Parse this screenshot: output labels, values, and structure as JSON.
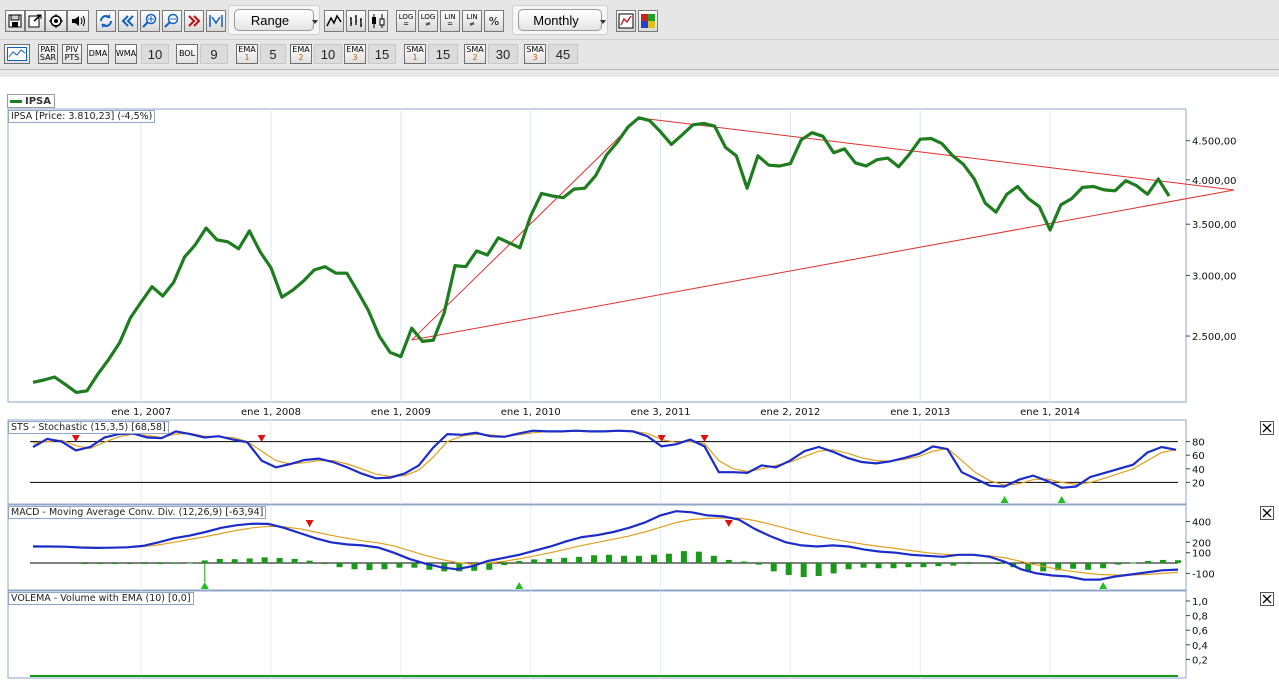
{
  "toolbar": {
    "range_label": "Range",
    "period_label": "Monthly",
    "icons": [
      "save-icon",
      "export-icon",
      "settings-icon",
      "sound-icon",
      "refresh-icon",
      "scroll-back-icon",
      "zoom-in-icon",
      "zoom-out-icon",
      "fast-forward-icon",
      "fit-icon",
      "line-chart-icon",
      "bar-chart-icon",
      "candlestick-icon",
      "log-equal-icon",
      "log-notequal-icon",
      "lin-equal-icon",
      "lin-notequal-icon",
      "percent-icon",
      "chart-settings-icon",
      "color-palette-icon"
    ],
    "scale_buttons": [
      {
        "top": "LOG",
        "bottom": "="
      },
      {
        "top": "LOG",
        "bottom": "≠"
      },
      {
        "top": "LIN",
        "bottom": "="
      },
      {
        "top": "LIN",
        "bottom": "≠"
      },
      {
        "top": "%",
        "bottom": ""
      }
    ]
  },
  "indicators_bar": {
    "buttons": [
      {
        "top": "PAR",
        "bottom": "SAR"
      },
      {
        "top": "PIV",
        "bottom": "PTS"
      },
      {
        "top": "DMA",
        "bottom": ""
      },
      {
        "top": "WMA",
        "bottom": ""
      },
      {
        "top": "BOL",
        "bottom": ""
      },
      {
        "top": "EMA",
        "bottom": "1"
      },
      {
        "top": "EMA",
        "bottom": "2"
      },
      {
        "top": "EMA",
        "bottom": "3"
      },
      {
        "top": "SMA",
        "bottom": "1"
      },
      {
        "top": "SMA",
        "bottom": "2"
      },
      {
        "top": "SMA",
        "bottom": "3"
      }
    ],
    "values": [
      "10",
      "9",
      "5",
      "10",
      "15",
      "15",
      "30",
      "45"
    ]
  },
  "legend": {
    "symbol": "IPSA"
  },
  "price_panel": {
    "label": "IPSA [Price: 3.810,23] (-4,5%)",
    "y_ticks": [
      "4.500,00",
      "4.000,00",
      "3.500,00",
      "3.000,00",
      "2.500,00"
    ],
    "x_ticks": [
      "ene 1, 2007",
      "ene 1, 2008",
      "ene 1, 2009",
      "ene 1, 2010",
      "ene 3, 2011",
      "ene 2, 2012",
      "ene 1, 2013",
      "ene 1, 2014"
    ],
    "line_color": "#1e7d1e",
    "trend_color": "#e03030"
  },
  "stochastic_panel": {
    "label": "STS - Stochastic (15,3,5) [68,58]",
    "y_ticks": [
      "80",
      "60",
      "40",
      "20"
    ]
  },
  "macd_panel": {
    "label": "MACD - Moving Average Conv. Div. (12,26,9) [-63,94]",
    "y_ticks": [
      "400",
      "200",
      "100",
      "-100"
    ]
  },
  "volume_panel": {
    "label": "VOLEMA - Volume with EMA (10) [0,0]",
    "y_ticks": [
      "1,0",
      "0,8",
      "0,6",
      "0,4",
      "0,2"
    ]
  },
  "chart_data": [
    {
      "type": "line",
      "title": "IPSA [Price: 3.810,23] (-4,5%)",
      "series": [
        {
          "name": "IPSA",
          "x": [
            "2006-03",
            "2006-04",
            "2006-05",
            "2006-06",
            "2006-07",
            "2006-08",
            "2006-09",
            "2006-10",
            "2006-11",
            "2006-12",
            "2007-01",
            "2007-02",
            "2007-03",
            "2007-04",
            "2007-05",
            "2007-06",
            "2007-07",
            "2007-08",
            "2007-09",
            "2007-10",
            "2007-11",
            "2007-12",
            "2008-01",
            "2008-02",
            "2008-03",
            "2008-04",
            "2008-05",
            "2008-06",
            "2008-07",
            "2008-08",
            "2008-09",
            "2008-10",
            "2008-11",
            "2008-12",
            "2009-01",
            "2009-02",
            "2009-03",
            "2009-04",
            "2009-05",
            "2009-06",
            "2009-07",
            "2009-08",
            "2009-09",
            "2009-10",
            "2009-11",
            "2009-12",
            "2010-01",
            "2010-02",
            "2010-03",
            "2010-04",
            "2010-05",
            "2010-06",
            "2010-07",
            "2010-08",
            "2010-09",
            "2010-10",
            "2010-11",
            "2010-12",
            "2011-01",
            "2011-02",
            "2011-03",
            "2011-04",
            "2011-05",
            "2011-06",
            "2011-07",
            "2011-08",
            "2011-09",
            "2011-10",
            "2011-11",
            "2011-12",
            "2012-01",
            "2012-02",
            "2012-03",
            "2012-04",
            "2012-05",
            "2012-06",
            "2012-07",
            "2012-08",
            "2012-09",
            "2012-10",
            "2012-11",
            "2012-12",
            "2013-01",
            "2013-02",
            "2013-03",
            "2013-04",
            "2013-05",
            "2013-06",
            "2013-07",
            "2013-08",
            "2013-09",
            "2013-10",
            "2013-11",
            "2013-12",
            "2014-01",
            "2014-02",
            "2014-03",
            "2014-04",
            "2014-05",
            "2014-06",
            "2014-07",
            "2014-08",
            "2014-09",
            "2014-10",
            "2014-11",
            "2014-12"
          ],
          "values": [
            2175,
            2190,
            2210,
            2160,
            2110,
            2120,
            2230,
            2330,
            2450,
            2640,
            2770,
            2900,
            2820,
            2940,
            3170,
            3290,
            3460,
            3340,
            3320,
            3250,
            3430,
            3220,
            3070,
            2810,
            2870,
            2950,
            3050,
            3080,
            3020,
            3020,
            2860,
            2700,
            2500,
            2380,
            2350,
            2560,
            2460,
            2470,
            2680,
            3090,
            3080,
            3230,
            3190,
            3360,
            3310,
            3260,
            3590,
            3840,
            3810,
            3790,
            3890,
            3900,
            4050,
            4310,
            4480,
            4690,
            4820,
            4780,
            4620,
            4450,
            4580,
            4720,
            4740,
            4700,
            4410,
            4300,
            3900,
            4300,
            4180,
            4170,
            4200,
            4510,
            4610,
            4560,
            4340,
            4390,
            4210,
            4170,
            4250,
            4270,
            4160,
            4320,
            4520,
            4530,
            4460,
            4300,
            4190,
            4010,
            3730,
            3630,
            3830,
            3920,
            3780,
            3690,
            3440,
            3710,
            3780,
            3910,
            3920,
            3880,
            3870,
            3990,
            3930,
            3830,
            4010,
            3810
          ]
        }
      ],
      "ylim": [
        2050,
        4950
      ],
      "y_scale": "log",
      "trendlines": [
        {
          "from": [
            "2009-02",
            2470
          ],
          "to": [
            "2010-11",
            4820
          ]
        },
        {
          "from": [
            "2009-02",
            2470
          ],
          "to": [
            "2015-06",
            3880
          ]
        },
        {
          "from": [
            "2010-11",
            4820
          ],
          "to": [
            "2015-06",
            3880
          ]
        }
      ]
    },
    {
      "type": "line",
      "title": "STS - Stochastic (15,3,5) [68,58]",
      "ylim": [
        0,
        100
      ],
      "reference_lines": [
        80,
        20
      ],
      "series": [
        {
          "name": "%K",
          "values": [
            72,
            84,
            80,
            67,
            72,
            86,
            91,
            92,
            86,
            85,
            95,
            91,
            86,
            88,
            83,
            79,
            52,
            42,
            47,
            53,
            55,
            50,
            42,
            33,
            26,
            27,
            33,
            45,
            71,
            91,
            90,
            93,
            88,
            87,
            92,
            96,
            95,
            95,
            96,
            95,
            95,
            96,
            95,
            88,
            73,
            76,
            83,
            73,
            35,
            35,
            34,
            45,
            42,
            52,
            66,
            72,
            65,
            56,
            50,
            48,
            51,
            56,
            62,
            73,
            69,
            35,
            25,
            15,
            14,
            24,
            30,
            22,
            12,
            14,
            28,
            34,
            40,
            46,
            64,
            72,
            68
          ]
        },
        {
          "name": "%D",
          "values": [
            78,
            80,
            82,
            74,
            70,
            79,
            87,
            91,
            89,
            86,
            91,
            92,
            88,
            87,
            86,
            80,
            66,
            52,
            47,
            49,
            52,
            52,
            47,
            40,
            32,
            29,
            30,
            38,
            57,
            80,
            88,
            91,
            90,
            88,
            90,
            93,
            95,
            95,
            95,
            95,
            95,
            95,
            95,
            92,
            83,
            79,
            80,
            77,
            52,
            40,
            36,
            40,
            45,
            50,
            58,
            66,
            68,
            63,
            56,
            52,
            51,
            54,
            58,
            66,
            70,
            52,
            34,
            22,
            16,
            18,
            24,
            25,
            20,
            17,
            20,
            26,
            33,
            40,
            52,
            64,
            68
          ]
        }
      ],
      "markers": [
        {
          "kind": "sell",
          "at": 3
        },
        {
          "kind": "sell",
          "at": 16
        },
        {
          "kind": "sell",
          "at": 44
        },
        {
          "kind": "sell",
          "at": 47
        },
        {
          "kind": "buy",
          "at": 68
        },
        {
          "kind": "buy",
          "at": 72
        }
      ]
    },
    {
      "type": "line",
      "title": "MACD - Moving Average Conv. Div. (12,26,9) [-63,94]",
      "ylim": [
        -260,
        560
      ],
      "series": [
        {
          "name": "MACD",
          "values": [
            160,
            160,
            158,
            150,
            146,
            148,
            152,
            165,
            200,
            240,
            265,
            300,
            340,
            365,
            380,
            378,
            340,
            290,
            240,
            200,
            180,
            170,
            150,
            100,
            40,
            -5,
            -40,
            -60,
            -30,
            20,
            50,
            80,
            120,
            160,
            210,
            250,
            270,
            300,
            340,
            390,
            460,
            500,
            490,
            460,
            450,
            420,
            330,
            260,
            200,
            170,
            160,
            170,
            160,
            130,
            110,
            100,
            80,
            70,
            60,
            80,
            80,
            60,
            10,
            -60,
            -100,
            -120,
            -130,
            -160,
            -160,
            -130,
            -110,
            -90,
            -70,
            -63
          ]
        },
        {
          "name": "Signal",
          "values": [
            165,
            162,
            160,
            155,
            150,
            148,
            150,
            158,
            175,
            200,
            228,
            255,
            285,
            315,
            340,
            355,
            350,
            330,
            300,
            268,
            240,
            215,
            195,
            165,
            120,
            75,
            35,
            5,
            -10,
            0,
            15,
            40,
            70,
            100,
            135,
            170,
            200,
            230,
            260,
            300,
            345,
            390,
            420,
            430,
            435,
            435,
            410,
            375,
            335,
            295,
            260,
            230,
            205,
            180,
            160,
            140,
            120,
            100,
            85,
            80,
            78,
            70,
            50,
            15,
            -20,
            -50,
            -75,
            -95,
            -110,
            -115,
            -115,
            -110,
            -100,
            -90
          ]
        }
      ],
      "histogram": [
        -5,
        -2,
        0,
        -5,
        -4,
        0,
        2,
        7,
        25,
        40,
        37,
        45,
        55,
        50,
        40,
        23,
        -10,
        -40,
        -60,
        -68,
        -60,
        -45,
        -45,
        -65,
        -80,
        -80,
        -75,
        -65,
        -20,
        20,
        35,
        40,
        50,
        60,
        75,
        80,
        70,
        70,
        80,
        90,
        115,
        110,
        70,
        30,
        15,
        -15,
        -80,
        -115,
        -135,
        -125,
        -100,
        -60,
        -45,
        -50,
        -50,
        -40,
        -40,
        -30,
        -25,
        0,
        2,
        -10,
        -40,
        -75,
        -80,
        -70,
        -55,
        -65,
        -50,
        -15,
        5,
        20,
        30,
        27
      ],
      "markers": [
        {
          "kind": "buy",
          "at": 8
        },
        {
          "kind": "sell",
          "at": 15
        },
        {
          "kind": "buy",
          "at": 29
        },
        {
          "kind": "sell",
          "at": 43
        },
        {
          "kind": "buy",
          "at": 68
        }
      ]
    },
    {
      "type": "bar",
      "title": "VOLEMA - Volume with EMA (10) [0,0]",
      "ylim": [
        0,
        1.0
      ],
      "values": [
        0
      ]
    }
  ]
}
